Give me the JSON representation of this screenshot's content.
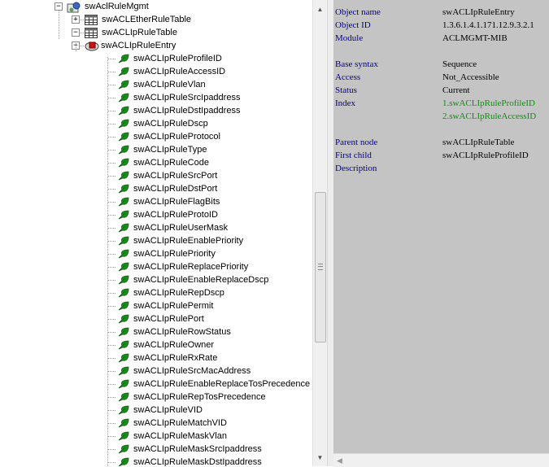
{
  "tree": {
    "nodes": [
      {
        "label": "swAclRuleMgmt",
        "level": 0,
        "icon": "folder-network-icon",
        "expander": "minus"
      },
      {
        "label": "swACLEtherRuleTable",
        "level": 1,
        "icon": "table-icon",
        "expander": "plus"
      },
      {
        "label": "swACLIpRuleTable",
        "level": 1,
        "icon": "table-icon",
        "expander": "minus"
      },
      {
        "label": "swACLIpRuleEntry",
        "level": 2,
        "icon": "entry-icon",
        "expander": "minus"
      },
      {
        "label": "swACLIpRuleProfileID",
        "level": 3,
        "icon": "leaf-icon"
      },
      {
        "label": "swACLIpRuleAccessID",
        "level": 3,
        "icon": "leaf-icon"
      },
      {
        "label": "swACLIpRuleVlan",
        "level": 3,
        "icon": "leaf-icon"
      },
      {
        "label": "swACLIpRuleSrcIpaddress",
        "level": 3,
        "icon": "leaf-icon"
      },
      {
        "label": "swACLIpRuleDstIpaddress",
        "level": 3,
        "icon": "leaf-icon"
      },
      {
        "label": "swACLIpRuleDscp",
        "level": 3,
        "icon": "leaf-icon"
      },
      {
        "label": "swACLIpRuleProtocol",
        "level": 3,
        "icon": "leaf-icon"
      },
      {
        "label": "swACLIpRuleType",
        "level": 3,
        "icon": "leaf-icon"
      },
      {
        "label": "swACLIpRuleCode",
        "level": 3,
        "icon": "leaf-icon"
      },
      {
        "label": "swACLIpRuleSrcPort",
        "level": 3,
        "icon": "leaf-icon"
      },
      {
        "label": "swACLIpRuleDstPort",
        "level": 3,
        "icon": "leaf-icon"
      },
      {
        "label": "swACLIpRuleFlagBits",
        "level": 3,
        "icon": "leaf-icon"
      },
      {
        "label": "swACLIpRuleProtoID",
        "level": 3,
        "icon": "leaf-icon"
      },
      {
        "label": "swACLIpRuleUserMask",
        "level": 3,
        "icon": "leaf-icon"
      },
      {
        "label": "swACLIpRuleEnablePriority",
        "level": 3,
        "icon": "leaf-icon"
      },
      {
        "label": "swACLIpRulePriority",
        "level": 3,
        "icon": "leaf-icon"
      },
      {
        "label": "swACLIpRuleReplacePriority",
        "level": 3,
        "icon": "leaf-icon"
      },
      {
        "label": "swACLIpRuleEnableReplaceDscp",
        "level": 3,
        "icon": "leaf-icon"
      },
      {
        "label": "swACLIpRuleRepDscp",
        "level": 3,
        "icon": "leaf-icon"
      },
      {
        "label": "swACLIpRulePermit",
        "level": 3,
        "icon": "leaf-icon"
      },
      {
        "label": "swACLIpRulePort",
        "level": 3,
        "icon": "leaf-icon"
      },
      {
        "label": "swACLIpRuleRowStatus",
        "level": 3,
        "icon": "leaf-icon"
      },
      {
        "label": "swACLIpRuleOwner",
        "level": 3,
        "icon": "leaf-icon"
      },
      {
        "label": "swACLIpRuleRxRate",
        "level": 3,
        "icon": "leaf-icon"
      },
      {
        "label": "swACLIpRuleSrcMacAddress",
        "level": 3,
        "icon": "leaf-icon"
      },
      {
        "label": "swACLIpRuleEnableReplaceTosPrecedence",
        "level": 3,
        "icon": "leaf-icon"
      },
      {
        "label": "swACLIpRuleRepTosPrecedence",
        "level": 3,
        "icon": "leaf-icon"
      },
      {
        "label": "swACLIpRuleVID",
        "level": 3,
        "icon": "leaf-icon"
      },
      {
        "label": "swACLIpRuleMatchVID",
        "level": 3,
        "icon": "leaf-icon"
      },
      {
        "label": "swACLIpRuleMaskVlan",
        "level": 3,
        "icon": "leaf-icon"
      },
      {
        "label": "swACLIpRuleMaskSrcIpaddress",
        "level": 3,
        "icon": "leaf-icon"
      },
      {
        "label": "swACLIpRuleMaskDstIpaddress",
        "level": 3,
        "icon": "leaf-icon"
      }
    ]
  },
  "info": {
    "rows": [
      {
        "key": "Object name",
        "value": "swACLIpRuleEntry"
      },
      {
        "key": "Object ID",
        "value": "1.3.6.1.4.1.171.12.9.3.2.1"
      },
      {
        "key": "Module",
        "value": "ACLMGMT-MIB"
      },
      {
        "key": "Base syntax",
        "value": "Sequence"
      },
      {
        "key": "Access",
        "value": "Not_Accessible"
      },
      {
        "key": "Status",
        "value": "Current"
      },
      {
        "key": "Index",
        "value": "1.swACLIpRuleProfileID",
        "link": true
      },
      {
        "key": "",
        "value": "2.swACLIpRuleAccessID",
        "link": true
      },
      {
        "key": "Parent node",
        "value": "swACLIpRuleTable"
      },
      {
        "key": "First child",
        "value": "swACLIpRuleProfileID"
      },
      {
        "key": "Description",
        "value": ""
      }
    ]
  },
  "colors": {
    "info_background": "#c4c4c4",
    "key_text": "#000099",
    "link_text": "#009900",
    "leaf_icon": "#1f8a1f"
  }
}
